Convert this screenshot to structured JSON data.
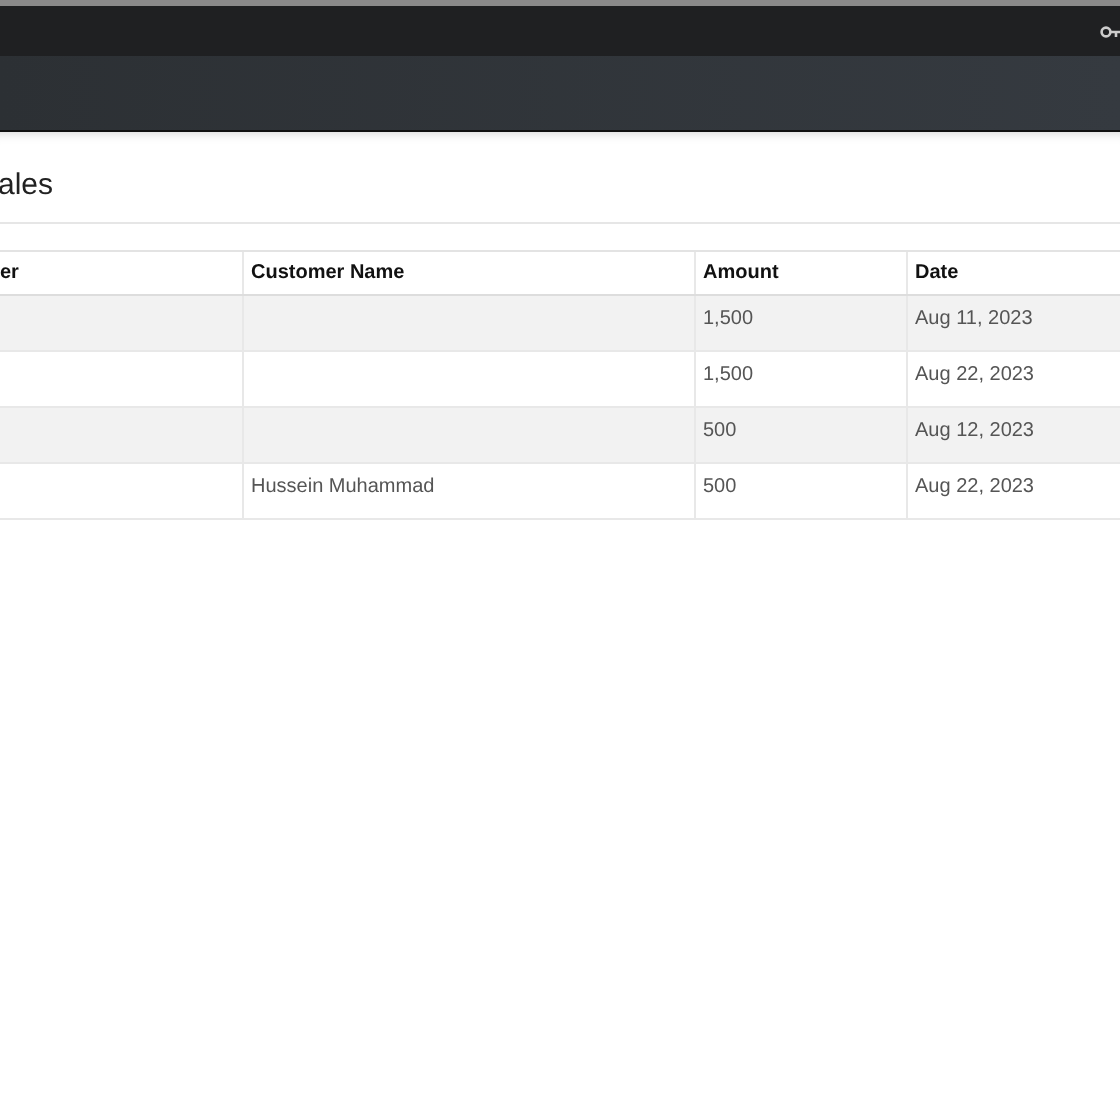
{
  "page": {
    "title": "ales"
  },
  "table": {
    "columns": [
      "er",
      "Customer Name",
      "Amount",
      "Date"
    ],
    "rows": [
      {
        "amount": "1,500",
        "date": "Aug 11, 2023"
      },
      {
        "amount": "1,500",
        "date": "Aug 22, 2023"
      },
      {
        "amount": "500",
        "date": "Aug 12, 2023"
      },
      {
        "customer_name": "Hussein Muhammad",
        "amount": "500",
        "date": "Aug 22, 2023"
      }
    ]
  }
}
